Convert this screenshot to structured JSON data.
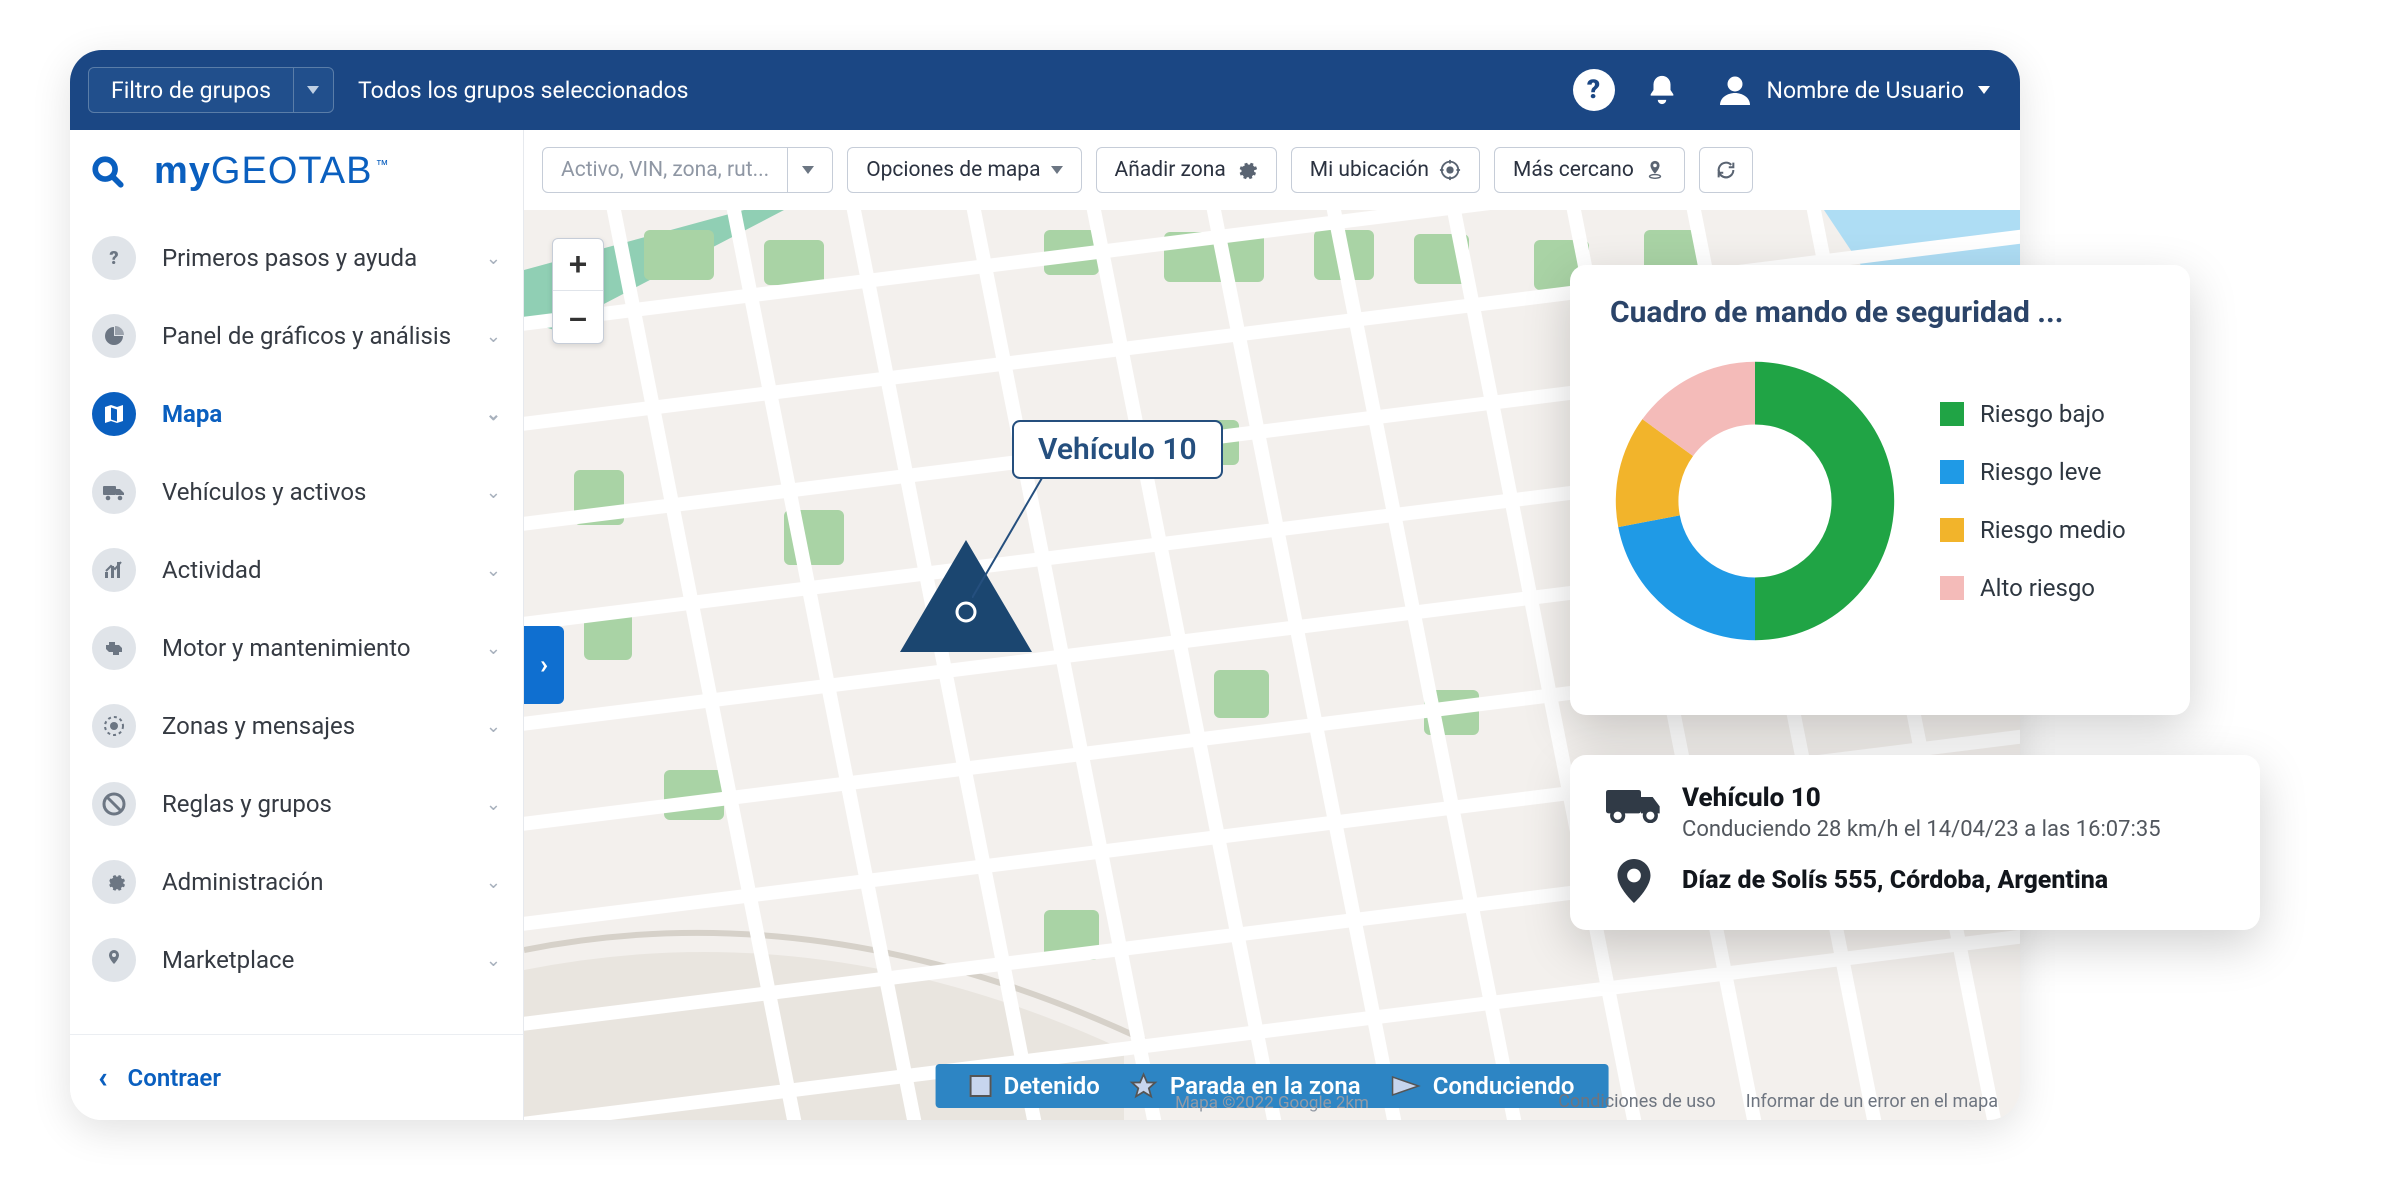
{
  "topbar": {
    "filter_label": "Filtro de grupos",
    "groups_selected": "Todos los grupos seleccionados",
    "username": "Nombre de Usuario"
  },
  "logo": {
    "my": "my",
    "rest": "GEOTAB",
    "tm": "™"
  },
  "sidebar": {
    "items": [
      {
        "label": "Primeros pasos y ayuda",
        "icon": "question"
      },
      {
        "label": "Panel de gráficos y análisis",
        "icon": "chart"
      },
      {
        "label": "Mapa",
        "icon": "map",
        "active": true
      },
      {
        "label": "Vehículos y activos",
        "icon": "truck"
      },
      {
        "label": "Actividad",
        "icon": "activity"
      },
      {
        "label": "Motor y mantenimiento",
        "icon": "engine"
      },
      {
        "label": "Zonas y mensajes",
        "icon": "zones"
      },
      {
        "label": "Reglas y grupos",
        "icon": "rules"
      },
      {
        "label": "Administración",
        "icon": "gear"
      },
      {
        "label": "Marketplace",
        "icon": "marketplace"
      }
    ],
    "collapse_label": "Contraer"
  },
  "toolbar": {
    "search_placeholder": "Activo, VIN, zona, rut...",
    "map_options": "Opciones de mapa",
    "add_zone": "Añadir zona",
    "my_location": "Mi ubicación",
    "nearest": "Más cercano"
  },
  "map": {
    "vehicle_label": "Vehículo 10",
    "zoom_in": "+",
    "zoom_out": "–",
    "attribution": "Mapa ©2022 Google   2km",
    "legend": {
      "stopped": "Detenido",
      "in_zone": "Parada en la zona",
      "driving": "Conduciendo"
    },
    "footer": {
      "terms": "Condiciones de uso",
      "report": "Informar de un error en el mapa"
    }
  },
  "safety_panel": {
    "title": "Cuadro de mando de seguridad ...",
    "legend": [
      {
        "label": "Riesgo bajo",
        "color": "#20a445"
      },
      {
        "label": "Riesgo leve",
        "color": "#1f9ae6"
      },
      {
        "label": "Riesgo medio",
        "color": "#f2b42b"
      },
      {
        "label": "Alto riesgo",
        "color": "#f4bbb9"
      }
    ]
  },
  "chart_data": {
    "type": "pie",
    "title": "Cuadro de mando de seguridad",
    "categories": [
      "Riesgo bajo",
      "Riesgo leve",
      "Riesgo medio",
      "Alto riesgo"
    ],
    "values": [
      50,
      22,
      13,
      15
    ],
    "colors": [
      "#20a445",
      "#1f9ae6",
      "#f2b42b",
      "#f4bbb9"
    ],
    "donut_hole": 0.55
  },
  "info_panel": {
    "vehicle_name": "Vehículo 10",
    "status_line": "Conduciendo 28 km/h el 14/04/23 a las 16:07:35",
    "address": "Díaz de Solís 555, Córdoba, Argentina"
  }
}
